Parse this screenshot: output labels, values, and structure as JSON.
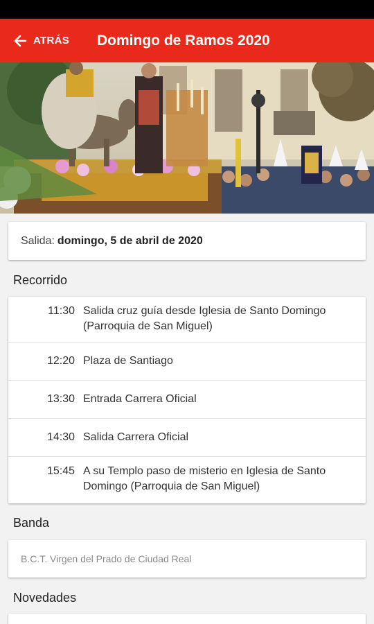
{
  "app_bar": {
    "back_label": "ATRÁS",
    "title": "Domingo de Ramos 2020",
    "color": "#e8291c"
  },
  "hero": {
    "icon": "procession-photo"
  },
  "salida": {
    "label": "Salida:",
    "value": "domingo, 5 de abril de 2020"
  },
  "recorrido": {
    "title": "Recorrido",
    "rows": [
      {
        "time": "11:30",
        "place": "Salida cruz guía desde Iglesia de Santo Domingo (Parroquia de San Miguel)"
      },
      {
        "time": "12:20",
        "place": "Plaza de Santiago"
      },
      {
        "time": "13:30",
        "place": "Entrada Carrera Oficial"
      },
      {
        "time": "14:30",
        "place": "Salida Carrera Oficial"
      },
      {
        "time": "15:45",
        "place": "A su Templo paso de misterio en Iglesia de Santo Domingo (Parroquia de San Miguel)"
      }
    ]
  },
  "banda": {
    "title": "Banda",
    "value": "B.C.T. Virgen del Prado de Ciudad Real"
  },
  "novedades": {
    "title": "Novedades"
  }
}
